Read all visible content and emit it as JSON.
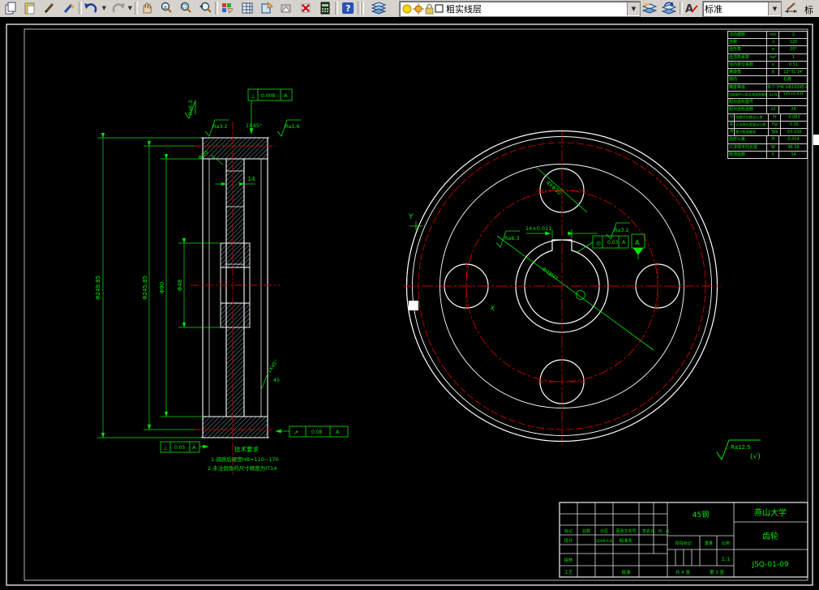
{
  "toolbar": {
    "icons": [
      "copy-icon",
      "paste-icon",
      "pencil-icon",
      "match-properties-icon",
      "undo-icon",
      "redo-icon",
      "pan-hand-icon",
      "zoom-realtime-icon",
      "zoom-window-icon",
      "zoom-previous-icon",
      "color-palette-icon",
      "table-icon",
      "sheet-set-icon",
      "markup-icon",
      "erase-icon",
      "calculator-icon",
      "help-icon",
      "layers-icon",
      "layer-previous-icon",
      "layer-states-icon",
      "text-style-icon",
      "dim-style-icon"
    ],
    "layer_combo": "粗实线层",
    "style_combo": "标准",
    "right_partial": "标"
  },
  "drawing": {
    "dims": {
      "d1": "Φ249.85",
      "d2": "Φ245.85",
      "d3": "Φ90",
      "d4": "Φ48",
      "web": "14",
      "small_hole": "Φ30",
      "ra_top_left": "Ra6.3",
      "ra_top1": "Ra3.2",
      "chamfer_top": "1X45°",
      "ra_top2": "Ra1.6",
      "chamfer_bottom": "1X45°",
      "hub_len": "45",
      "hole_note": "4XΦ30",
      "bore": "Φ48H7",
      "key_width": "14±0.011",
      "ra_right1": "Ra6.3",
      "ra_right2": "Ra3.2",
      "section_y": "Y",
      "section_x": "X",
      "surface_note": "Ra12.5",
      "surface_note2": "(√)"
    },
    "frames": {
      "top": {
        "sym": "⊥",
        "val": "0.008",
        "ref": "A"
      },
      "bl": {
        "sym": "⊥",
        "val": "0.05",
        "ref": "A"
      },
      "br": {
        "sym": "↗",
        "val": "0.08",
        "ref": "A"
      },
      "right": {
        "sym": "◎",
        "val": "0.03",
        "ref": "A"
      },
      "datum": "A"
    },
    "tech_req": {
      "title": "技术要求",
      "line1": "1.调质后硬度HB=110~170",
      "line2": "2.未注倒角的尺寸精度为IT14"
    }
  },
  "gear_table": {
    "rows": [
      {
        "n": "法向模数",
        "s": "mn",
        "v": "2"
      },
      {
        "n": "齿数",
        "s": "z",
        "v": "120"
      },
      {
        "n": "齿形角",
        "s": "α",
        "v": "20°"
      },
      {
        "n": "齿顶高系数",
        "s": "ha*",
        "v": "1"
      },
      {
        "n": "径向变位系数",
        "s": "x",
        "v": "0.51"
      },
      {
        "n": "螺旋角",
        "s": "β",
        "v": "12°31′34″"
      },
      {
        "n": "旋向",
        "s": "",
        "v": "右旋"
      },
      {
        "n": "精度等级",
        "s": "",
        "v": "8-7-7HK GB10095-88"
      },
      {
        "n": "齿轮副中心距及其极限偏差",
        "s": "a±fa",
        "v": "145±0.031"
      },
      {
        "n": "配对齿轮图号",
        "s": "",
        "v": ""
      },
      {
        "n": "配对齿轮齿数",
        "s": "z2",
        "v": "24"
      },
      {
        "g": "公",
        "n": "齿圈径向跳动公差",
        "s": "Fr",
        "v": "0.063"
      },
      {
        "g": "差",
        "n": "公法线长度变动公差",
        "s": "Fw",
        "v": "0.05"
      },
      {
        "g": "组",
        "n": "基节极限偏差",
        "s": "fpb",
        "v": "±0.016"
      },
      {
        "n": "齿形公差",
        "s": "ff",
        "v": "0.014"
      },
      {
        "n": "公法线平均长度",
        "s": "W",
        "v": "46.38"
      },
      {
        "n": "跨测齿数",
        "s": "k",
        "v": "14"
      }
    ]
  },
  "title_block": {
    "material": "45钢",
    "school": "燕山大学",
    "part": "齿轮",
    "number": "JSQ-01-09",
    "h1": "标记",
    "h2": "处数",
    "h3": "分区",
    "h4": "更改文件号",
    "h5": "签名",
    "h6": "年、月、日",
    "design": "设计",
    "design_date": "2009.6.8",
    "standard": "标准化",
    "check": "审核",
    "craft": "工艺",
    "approve": "批准",
    "stage": "阶段标记",
    "weight": "重量",
    "scale_label": "比例",
    "scale": "1:1",
    "sheets_total": "共 4 张",
    "sheet_no": "第 3 张"
  }
}
